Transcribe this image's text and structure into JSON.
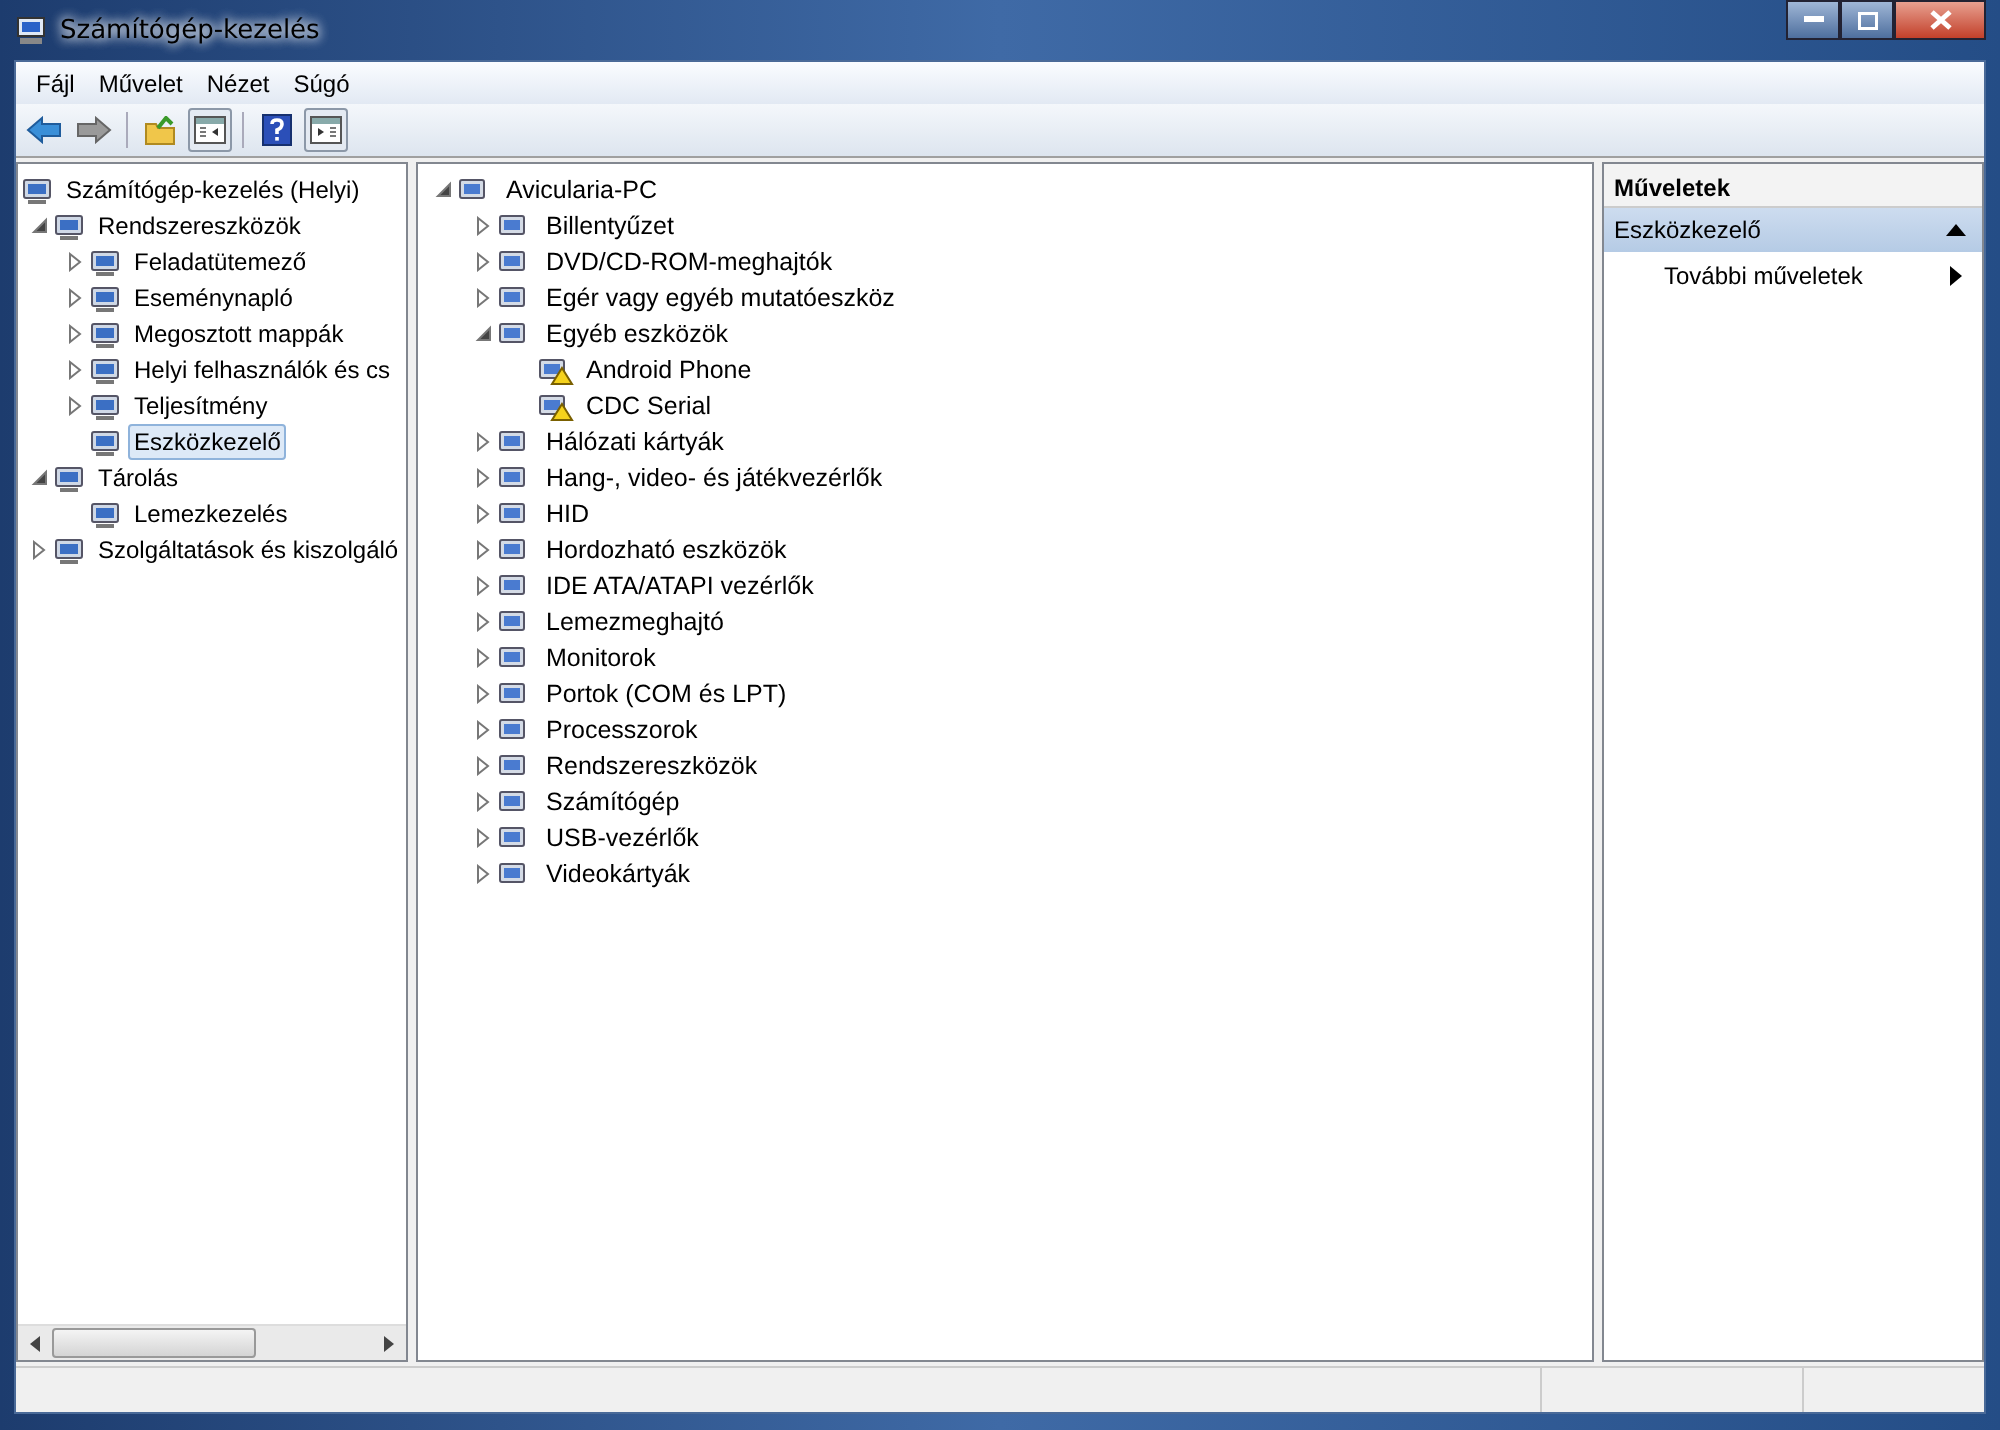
{
  "window": {
    "title": "Számítógép-kezelés"
  },
  "menu": [
    "Fájl",
    "Művelet",
    "Nézet",
    "Súgó"
  ],
  "left_tree": [
    {
      "label": "Számítógép-kezelés (Helyi)",
      "selected": false,
      "children": [
        {
          "label": "Rendszereszközök",
          "has_children": true,
          "expanded": true,
          "selected": false,
          "children": [
            {
              "label": "Feladatütemező",
              "has_children": true,
              "expanded": false,
              "selected": false
            },
            {
              "label": "Eseménynapló",
              "has_children": true,
              "expanded": false,
              "selected": false
            },
            {
              "label": "Megosztott mappák",
              "has_children": true,
              "expanded": false,
              "selected": false
            },
            {
              "label": "Helyi felhasználók és cs",
              "has_children": true,
              "expanded": false,
              "selected": false
            },
            {
              "label": "Teljesítmény",
              "has_children": true,
              "expanded": false,
              "selected": false
            },
            {
              "label": "Eszközkezelő",
              "has_children": false,
              "expanded": false,
              "selected": true
            }
          ]
        },
        {
          "label": "Tárolás",
          "has_children": true,
          "expanded": true,
          "selected": false,
          "children": [
            {
              "label": "Lemezkezelés",
              "has_children": false,
              "expanded": false,
              "selected": false
            }
          ]
        },
        {
          "label": "Szolgáltatások és kiszolgáló",
          "has_children": true,
          "expanded": false,
          "selected": false
        }
      ]
    }
  ],
  "device_tree": [
    {
      "label": "Avicularia-PC",
      "has_children": true,
      "expanded": true,
      "warning": false,
      "children": [
        {
          "label": "Billentyűzet",
          "has_children": true,
          "expanded": false,
          "warning": false
        },
        {
          "label": "DVD/CD-ROM-meghajtók",
          "has_children": true,
          "expanded": false,
          "warning": false
        },
        {
          "label": "Egér vagy egyéb mutatóeszköz",
          "has_children": true,
          "expanded": false,
          "warning": false
        },
        {
          "label": "Egyéb eszközök",
          "has_children": true,
          "expanded": true,
          "warning": false,
          "children": [
            {
              "label": "Android Phone",
              "has_children": false,
              "expanded": false,
              "warning": true
            },
            {
              "label": "CDC Serial",
              "has_children": false,
              "expanded": false,
              "warning": true
            }
          ]
        },
        {
          "label": "Hálózati kártyák",
          "has_children": true,
          "expanded": false,
          "warning": false
        },
        {
          "label": "Hang-, video- és játékvezérlők",
          "has_children": true,
          "expanded": false,
          "warning": false
        },
        {
          "label": "HID",
          "has_children": true,
          "expanded": false,
          "warning": false
        },
        {
          "label": "Hordozható eszközök",
          "has_children": true,
          "expanded": false,
          "warning": false
        },
        {
          "label": "IDE ATA/ATAPI vezérlők",
          "has_children": true,
          "expanded": false,
          "warning": false
        },
        {
          "label": "Lemezmeghajtó",
          "has_children": true,
          "expanded": false,
          "warning": false
        },
        {
          "label": "Monitorok",
          "has_children": true,
          "expanded": false,
          "warning": false
        },
        {
          "label": "Portok (COM és LPT)",
          "has_children": true,
          "expanded": false,
          "warning": false
        },
        {
          "label": "Processzorok",
          "has_children": true,
          "expanded": false,
          "warning": false
        },
        {
          "label": "Rendszereszközök",
          "has_children": true,
          "expanded": false,
          "warning": false
        },
        {
          "label": "Számítógép",
          "has_children": true,
          "expanded": false,
          "warning": false
        },
        {
          "label": "USB-vezérlők",
          "has_children": true,
          "expanded": false,
          "warning": false
        },
        {
          "label": "Videokártyák",
          "has_children": true,
          "expanded": false,
          "warning": false
        }
      ]
    }
  ],
  "actions": {
    "title": "Műveletek",
    "section": "Eszközkezelő",
    "items": [
      "További műveletek"
    ]
  }
}
